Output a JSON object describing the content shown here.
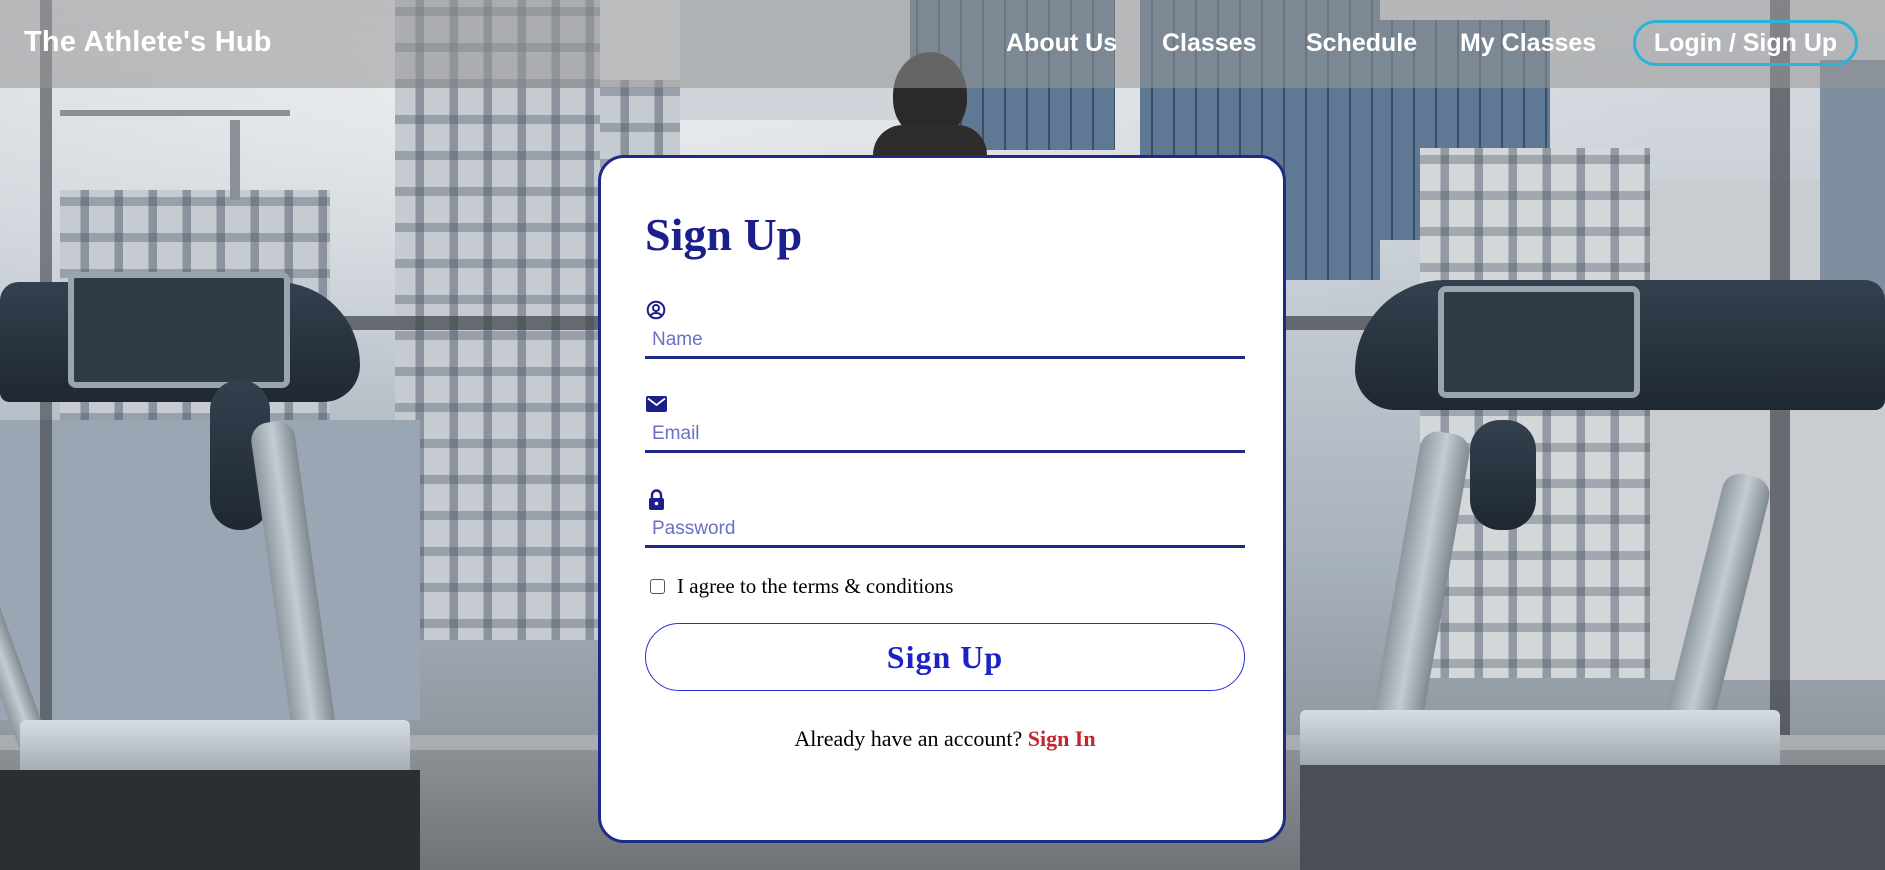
{
  "navbar": {
    "brand": "The Athlete's Hub",
    "links": [
      {
        "label": "About Us"
      },
      {
        "label": "Classes"
      },
      {
        "label": "Schedule"
      },
      {
        "label": "My Classes"
      }
    ],
    "login_label": "Login / Sign Up",
    "accent_color": "#29b6d6"
  },
  "form": {
    "title": "Sign Up",
    "name": {
      "icon": "user-circle-icon",
      "placeholder": "Name",
      "value": ""
    },
    "email": {
      "icon": "envelope-icon",
      "placeholder": "Email",
      "value": ""
    },
    "password": {
      "icon": "lock-icon",
      "placeholder": "Password",
      "value": ""
    },
    "terms_label": "I agree to the terms & conditions",
    "terms_checked": false,
    "submit_label": "Sign Up",
    "signin_prompt": "Already have an account?",
    "signin_link": "Sign In",
    "colors": {
      "primary": "#1f2a86",
      "button_text": "#1e22c4",
      "link": "#c4262b"
    }
  }
}
